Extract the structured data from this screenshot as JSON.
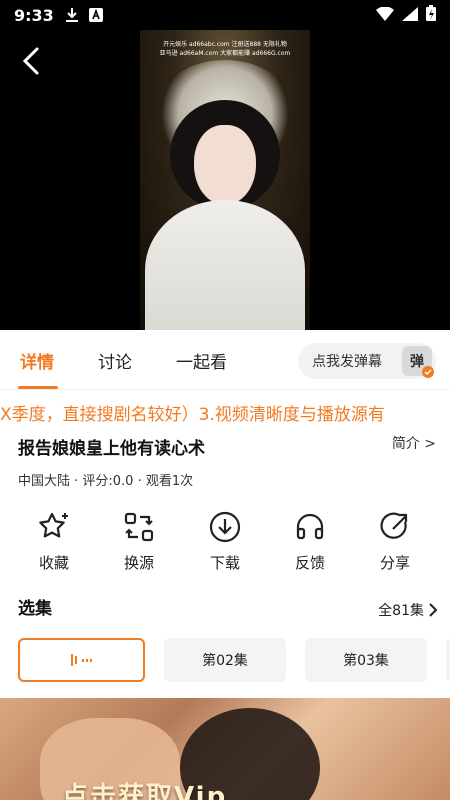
{
  "status_bar": {
    "time": "9:33",
    "icons": [
      "download-icon",
      "a-icon",
      "wifi-icon",
      "signal-icon",
      "battery-icon"
    ]
  },
  "video": {
    "back_icon": "back-arrow-icon",
    "subtitle_line1": "开元娱乐 ad66abc.com 注册送888 无限礼物",
    "subtitle_line2": "亚马逊 ad66aM.com 大家都能赚 ad666G.com"
  },
  "tabs": [
    {
      "label": "详情",
      "active": true
    },
    {
      "label": "讨论",
      "active": false
    },
    {
      "label": "一起看",
      "active": false
    }
  ],
  "danmaku": {
    "label": "点我发弹幕",
    "button": "弹"
  },
  "marquee": "X季度，直接搜剧名较好）3.视频清晰度与播放源有",
  "show": {
    "title": "报告娘娘皇上他有读心术",
    "intro_label": "简介 >",
    "meta": "中国大陆 · 评分:0.0 · 观看1次"
  },
  "actions": [
    {
      "label": "收藏",
      "icon": "star-icon"
    },
    {
      "label": "换源",
      "icon": "switch-source-icon"
    },
    {
      "label": "下载",
      "icon": "download-circle-icon"
    },
    {
      "label": "反馈",
      "icon": "headset-icon"
    },
    {
      "label": "分享",
      "icon": "share-icon"
    }
  ],
  "episodes": {
    "section_title": "选集",
    "all_label": "全81集",
    "items": [
      {
        "label": "",
        "playing": true
      },
      {
        "label": "第02集",
        "playing": false
      },
      {
        "label": "第03集",
        "playing": false
      }
    ]
  },
  "banner": {
    "cta": "点击获取Vip"
  },
  "colors": {
    "accent": "#f27b21",
    "status_bg": "#000000"
  }
}
